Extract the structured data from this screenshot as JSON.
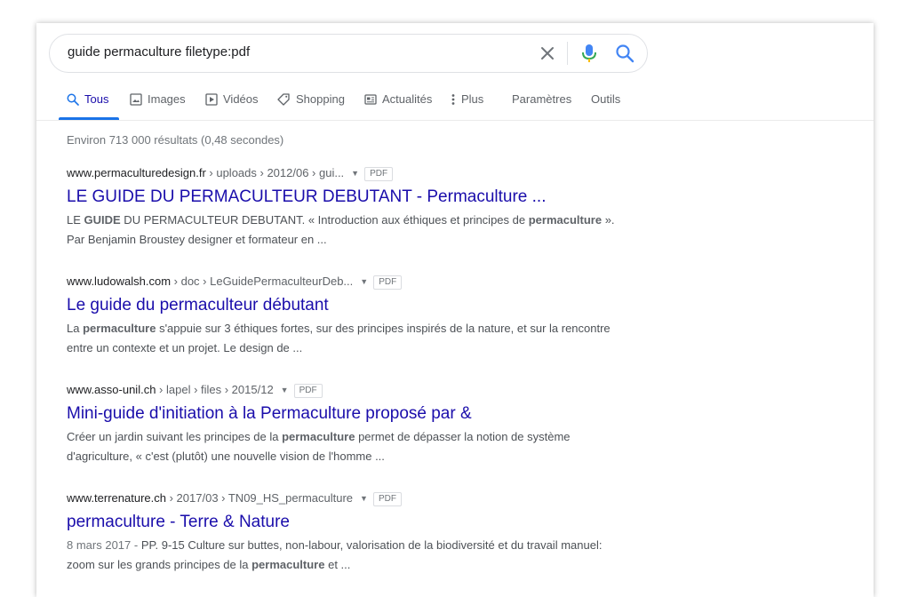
{
  "search": {
    "query": "guide permaculture filetype:pdf"
  },
  "tabs": [
    {
      "label": "Tous",
      "icon": "search-icon",
      "active": true
    },
    {
      "label": "Images",
      "icon": "image-icon",
      "active": false
    },
    {
      "label": "Vidéos",
      "icon": "video-icon",
      "active": false
    },
    {
      "label": "Shopping",
      "icon": "tag-icon",
      "active": false
    },
    {
      "label": "Actualités",
      "icon": "news-icon",
      "active": false
    },
    {
      "label": "Plus",
      "icon": "more-vert-icon",
      "active": false
    },
    {
      "label": "Paramètres",
      "icon": "",
      "active": false
    },
    {
      "label": "Outils",
      "icon": "",
      "active": false
    }
  ],
  "stats": "Environ 713 000 résultats (0,48 secondes)",
  "results": [
    {
      "domain": "www.permaculturedesign.fr",
      "path": " › uploads › 2012/06 › gui...",
      "badge": "PDF",
      "title": "LE GUIDE DU PERMACULTEUR DEBUTANT - Permaculture ...",
      "snippet": [
        {
          "t": "LE ",
          "b": false
        },
        {
          "t": "GUIDE",
          "b": true
        },
        {
          "t": " DU PERMACULTEUR DEBUTANT. « Introduction aux éthiques et principes de ",
          "b": false
        },
        {
          "t": "permaculture",
          "b": true
        },
        {
          "t": " ». Par Benjamin Broustey designer et formateur en ...",
          "b": false
        }
      ]
    },
    {
      "domain": "www.ludowalsh.com",
      "path": " › doc › LeGuidePermaculteurDeb...",
      "badge": "PDF",
      "title": "Le guide du permaculteur débutant",
      "snippet": [
        {
          "t": "La ",
          "b": false
        },
        {
          "t": "permaculture",
          "b": true
        },
        {
          "t": " s'appuie sur 3 éthiques fortes, sur des principes inspirés de la nature, et sur la rencontre entre un contexte et un projet. Le design de ...",
          "b": false
        }
      ]
    },
    {
      "domain": "www.asso-unil.ch",
      "path": " › lapel › files › 2015/12",
      "badge": "PDF",
      "title": "Mini-guide d'initiation à la Permaculture proposé par &",
      "snippet": [
        {
          "t": "Créer un jardin suivant les principes de la ",
          "b": false
        },
        {
          "t": "permaculture",
          "b": true
        },
        {
          "t": " permet de dépasser la notion de système d'agriculture, « c'est (plutôt) une nouvelle vision de l'homme ...",
          "b": false
        }
      ]
    },
    {
      "domain": "www.terrenature.ch",
      "path": " › 2017/03 › TN09_HS_permaculture",
      "badge": "PDF",
      "title": "permaculture - Terre & Nature",
      "date": "8 mars 2017 - ",
      "snippet": [
        {
          "t": "PP. 9-15 Culture sur buttes, non-labour, valorisation de la biodiversité et du travail manuel: zoom sur les grands principes de la ",
          "b": false
        },
        {
          "t": "permaculture",
          "b": true
        },
        {
          "t": " et ...",
          "b": false
        }
      ]
    }
  ],
  "colors": {
    "link": "#1a0dab",
    "active_tab_underline": "#1a73e8",
    "snippet": "#4d5156",
    "muted": "#70757a"
  }
}
